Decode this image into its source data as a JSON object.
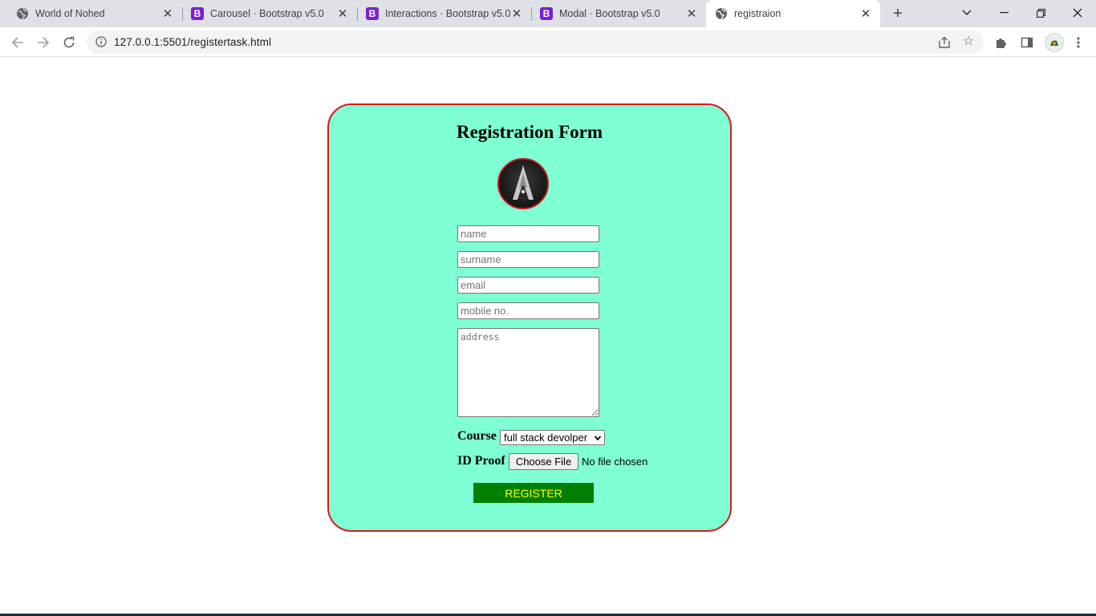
{
  "browser": {
    "tabs": [
      {
        "title": "World of Nohed",
        "icon": "globe-icon"
      },
      {
        "title": "Carousel · Bootstrap v5.0",
        "icon": "bootstrap-icon",
        "badge": "B"
      },
      {
        "title": "Interactions · Bootstrap v5.0",
        "icon": "bootstrap-icon",
        "badge": "B"
      },
      {
        "title": "Modal · Bootstrap v5.0",
        "icon": "bootstrap-icon",
        "badge": "B"
      },
      {
        "title": "registraion",
        "icon": "globe-icon",
        "active": true
      }
    ],
    "url": "127.0.0.1:5501/registertask.html"
  },
  "form": {
    "title": "Registration Form",
    "name_placeholder": "name",
    "surname_placeholder": "surname",
    "email_placeholder": "email",
    "mobile_placeholder": "mobile no.",
    "address_placeholder": "address",
    "course_label": "Course",
    "course_selected": "full stack devolper",
    "id_proof_label": "ID Proof",
    "file_button": "Choose File",
    "file_status": "No file chosen",
    "register_label": "REGISTER"
  },
  "colors": {
    "card_background": "#7fffd4",
    "card_border": "#d91a1a",
    "register_bg": "#008000",
    "register_text": "#ffff00"
  }
}
